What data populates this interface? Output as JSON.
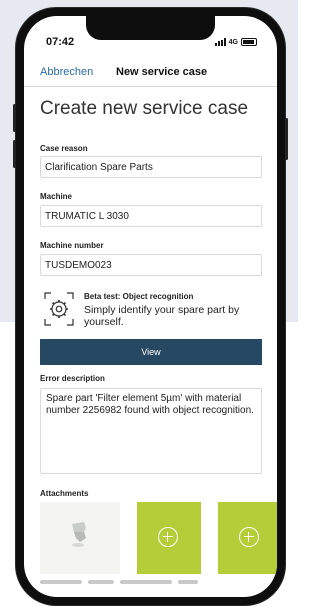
{
  "status_bar": {
    "time": "07:42",
    "network": "4G"
  },
  "nav": {
    "cancel_label": "Abbrechen",
    "title": "New service case"
  },
  "page": {
    "title": "Create new service case"
  },
  "form": {
    "case_reason": {
      "label": "Case reason",
      "value": "Clarification Spare Parts"
    },
    "machine": {
      "label": "Machine",
      "value": "TRUMATIC L 3030"
    },
    "machine_number": {
      "label": "Machine number",
      "value": "TUSDEMO023"
    }
  },
  "beta": {
    "title": "Beta test: Object recognition",
    "text": "Simply identify your spare part by yourself.",
    "button_label": "View",
    "icon": "gear-scan-icon"
  },
  "error": {
    "label": "Error description",
    "value": "Spare part 'Filter element  5µm' with material number 2256982 found with object recognition."
  },
  "attachments": {
    "label": "Attachments",
    "add_icon": "plus-circle-icon"
  },
  "colors": {
    "accent_green": "#b5cd38",
    "button_navy": "#274862",
    "link_blue": "#2b6aa6"
  }
}
